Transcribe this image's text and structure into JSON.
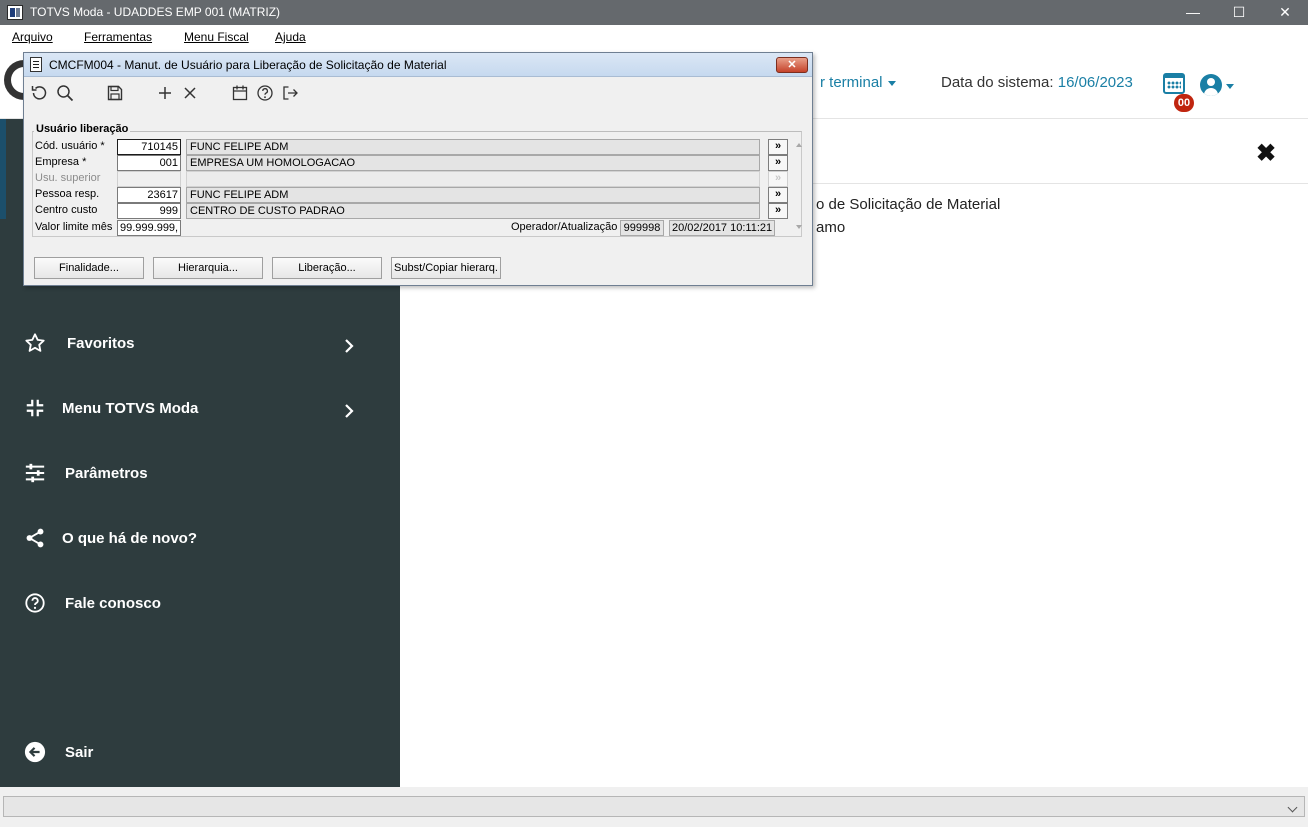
{
  "window": {
    "title": "TOTVS Moda - UDADDES EMP 001 (MATRIZ)",
    "minimize": "—",
    "maximize": "☐",
    "close": "✕"
  },
  "menubar": {
    "items": [
      "Arquivo",
      "Ferramentas",
      "Menu Fiscal",
      "Ajuda"
    ]
  },
  "header": {
    "terminal_text": "r terminal",
    "sys_date_label": "Data do sistema:",
    "sys_date_value": "16/06/2023",
    "calendar_badge": "00"
  },
  "sidebar": {
    "items": [
      {
        "label": "Favoritos",
        "icon": "star-icon",
        "has_chevron": true
      },
      {
        "label": "Menu TOTVS Moda",
        "icon": "collapse-icon",
        "has_chevron": true
      },
      {
        "label": "Parâmetros",
        "icon": "sliders-icon",
        "has_chevron": false
      },
      {
        "label": "O que há de novo?",
        "icon": "share-icon",
        "has_chevron": false
      },
      {
        "label": "Fale conosco",
        "icon": "help-icon",
        "has_chevron": false
      },
      {
        "label": "Sair",
        "icon": "arrow-left-icon",
        "has_chevron": false
      }
    ]
  },
  "content": {
    "close_icon": "✖",
    "line1": "o de Solicitação de Material",
    "line2": "amo"
  },
  "dialog": {
    "title": "CMCFM004 - Manut. de Usuário para Liberação de Solicitação de Material",
    "close": "✕",
    "toolbar": [
      "undo-icon",
      "search-icon",
      "save-icon",
      "add-icon",
      "delete-icon",
      "calendar-icon",
      "help-icon",
      "exit-icon"
    ],
    "group_title": "Usuário liberação",
    "fields": [
      {
        "label": "Cód. usuário *",
        "code": "710145",
        "desc": "FUNC FELIPE ADM",
        "button": "»",
        "enabled": true
      },
      {
        "label": "Empresa *",
        "code": "001",
        "desc": "EMPRESA UM HOMOLOGACAO",
        "button": "»",
        "enabled": true
      },
      {
        "label": "Usu. superior",
        "code": "",
        "desc": "",
        "button": "»",
        "enabled": false
      },
      {
        "label": "Pessoa resp.",
        "code": "23617",
        "desc": "FUNC FELIPE ADM",
        "button": "»",
        "enabled": true
      },
      {
        "label": "Centro custo",
        "code": "999",
        "desc": "CENTRO DE CUSTO PADRAO",
        "button": "»",
        "enabled": true
      }
    ],
    "limit_label": "Valor limite mês",
    "limit_value": "99.999.999,(",
    "operator_label": "Operador/Atualização",
    "operator_code": "999998",
    "operator_date": "20/02/2017 10:11:21",
    "buttons": [
      "Finalidade...",
      "Hierarquia...",
      "Liberação...",
      "Subst/Copiar hierarq."
    ]
  },
  "statusbar": {
    "value": ""
  }
}
